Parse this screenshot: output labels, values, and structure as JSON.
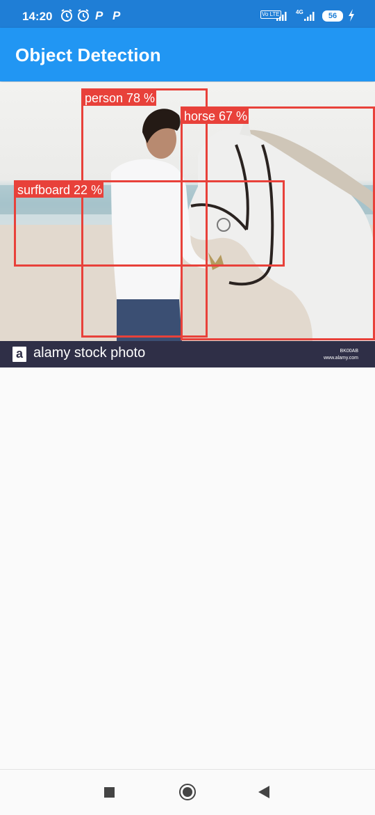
{
  "status_bar": {
    "time": "14:20",
    "icons": [
      "alarm-icon",
      "alarm-icon",
      "p-notification-icon",
      "p-notification-icon",
      "volte-icon",
      "signal-icon",
      "signal-icon"
    ],
    "p_label": "P",
    "volte_label": "Vo LTE",
    "network_label": "4G",
    "battery_level": "56"
  },
  "app_bar": {
    "title": "Object Detection",
    "color": "#2196f3"
  },
  "photo": {
    "watermark_text": "alamy stock photo",
    "watermark_logo": "a",
    "watermark_id": "BK00AB",
    "watermark_url": "www.alamy.com"
  },
  "detections": [
    {
      "label": "person 78 %",
      "class": "person",
      "confidence": 78
    },
    {
      "label": "horse 67 %",
      "class": "horse",
      "confidence": 67
    },
    {
      "label": "surfboard 22 %",
      "class": "surfboard",
      "confidence": 22
    }
  ],
  "box_color": "#e8413a",
  "nav_bar": {
    "buttons": [
      "recents-button",
      "home-button",
      "back-button"
    ]
  }
}
